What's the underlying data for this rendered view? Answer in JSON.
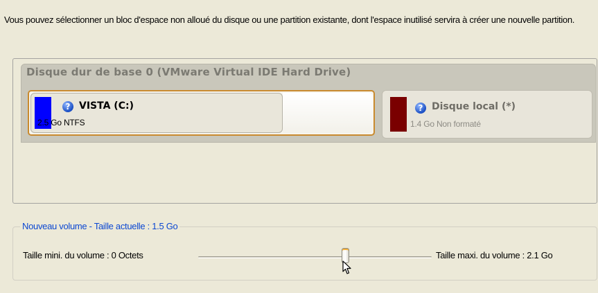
{
  "intro_text": "Vous pouvez sélectionner un bloc d'espace non alloué du disque ou une partition existante, dont l'espace inutilisé servira à créer une nouvelle partition.",
  "disk": {
    "title": "Disque dur de base 0 (VMware Virtual IDE Hard Drive)",
    "partitions": [
      {
        "name": "VISTA (C:)",
        "detail": "2.5 Go NTFS",
        "color": "#0000ff",
        "selected": true,
        "icon": "help-icon"
      },
      {
        "name": "Disque local (*)",
        "detail": "1.4 Go Non formaté",
        "color": "#7a0000",
        "selected": false,
        "icon": "help-icon"
      }
    ]
  },
  "volume": {
    "legend": "Nouveau volume - Taille actuelle : 1.5 Go",
    "min_label": "Taille mini. du volume :  0 Octets",
    "max_label": "Taille maxi. du volume :  2.1 Go",
    "slider_fraction": 0.63
  },
  "colors": {
    "accent": "#0b47d2",
    "selection": "#c98a2e"
  }
}
